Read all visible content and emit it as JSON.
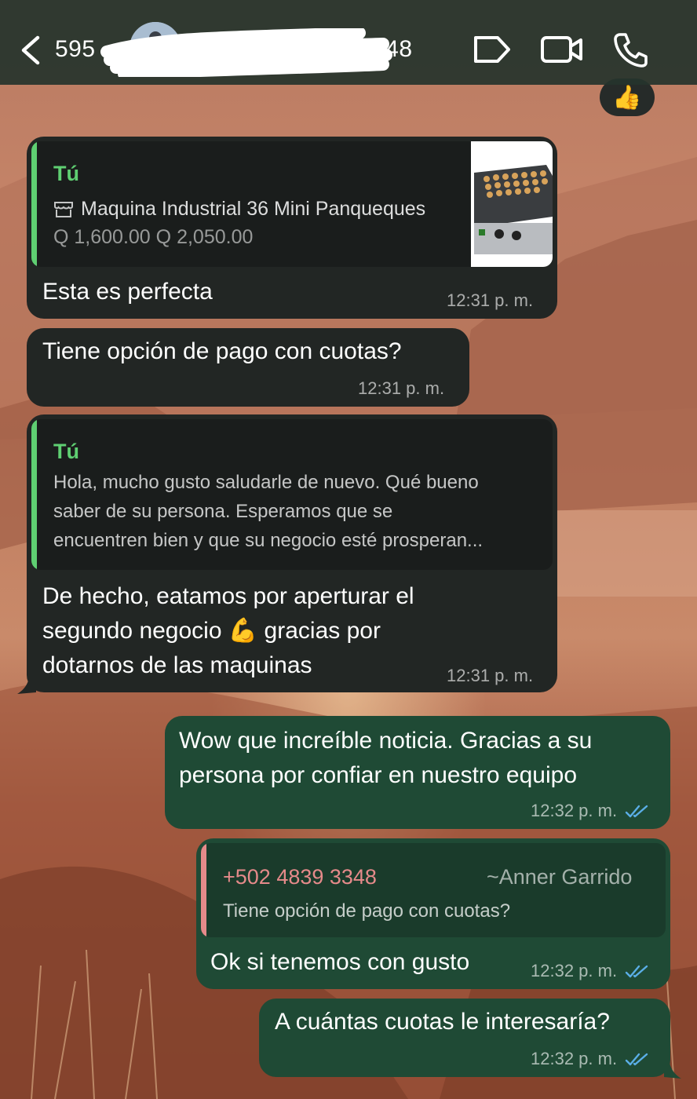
{
  "header": {
    "contact_name": "595",
    "contact_suffix": "348",
    "icons": [
      "back-chevron-icon",
      "tag-label-icon",
      "video-call-icon",
      "phone-call-icon"
    ]
  },
  "reaction": {
    "emoji": "👍"
  },
  "messages": [
    {
      "direction": "incoming",
      "quote": {
        "author": "Tú",
        "product_name": "Maquina Industrial 36 Mini Panqueques",
        "price_sale": "Q 1,600.00",
        "price_original": "Q 2,050.00",
        "thumbnail": "mini-pancake-machine"
      },
      "text": "Esta es perfecta",
      "time": "12:31 p. m."
    },
    {
      "direction": "incoming",
      "text": "Tiene opción de pago con cuotas?",
      "time": "12:31 p. m."
    },
    {
      "direction": "incoming",
      "quote": {
        "author": "Tú",
        "lines": [
          "Hola, mucho gusto saludarle de nuevo. Qué bueno",
          "saber de su persona. Esperamos que se",
          "encuentren bien y que su negocio esté prosperan..."
        ]
      },
      "text_lines": [
        "De hecho, eatamos por aperturar el",
        "segundo negocio 💪 gracias por",
        "dotarnos de las maquinas"
      ],
      "time": "12:31 p. m."
    },
    {
      "direction": "outgoing",
      "text_lines": [
        "Wow que increíble noticia. Gracias a su",
        "persona por confiar en nuestro equipo"
      ],
      "time": "12:32 p. m.",
      "status": "read"
    },
    {
      "direction": "outgoing",
      "quote": {
        "phone": "+502 4839 3348",
        "name": "~Anner Garrido",
        "text": "Tiene opción de pago con cuotas?"
      },
      "text": "Ok si tenemos con gusto",
      "time": "12:32 p. m.",
      "status": "read"
    },
    {
      "direction": "outgoing",
      "text": "A cuántas cuotas le interesaría?",
      "time": "12:32 p. m.",
      "status": "read"
    }
  ],
  "colors": {
    "header_bg": "#26342c",
    "incoming_bubble": "#222624",
    "outgoing_bubble": "#1f4a35",
    "quote_author_you": "#5fcf72",
    "quote_author_other": "#e58a8a",
    "read_ticks": "#5aaee6"
  }
}
